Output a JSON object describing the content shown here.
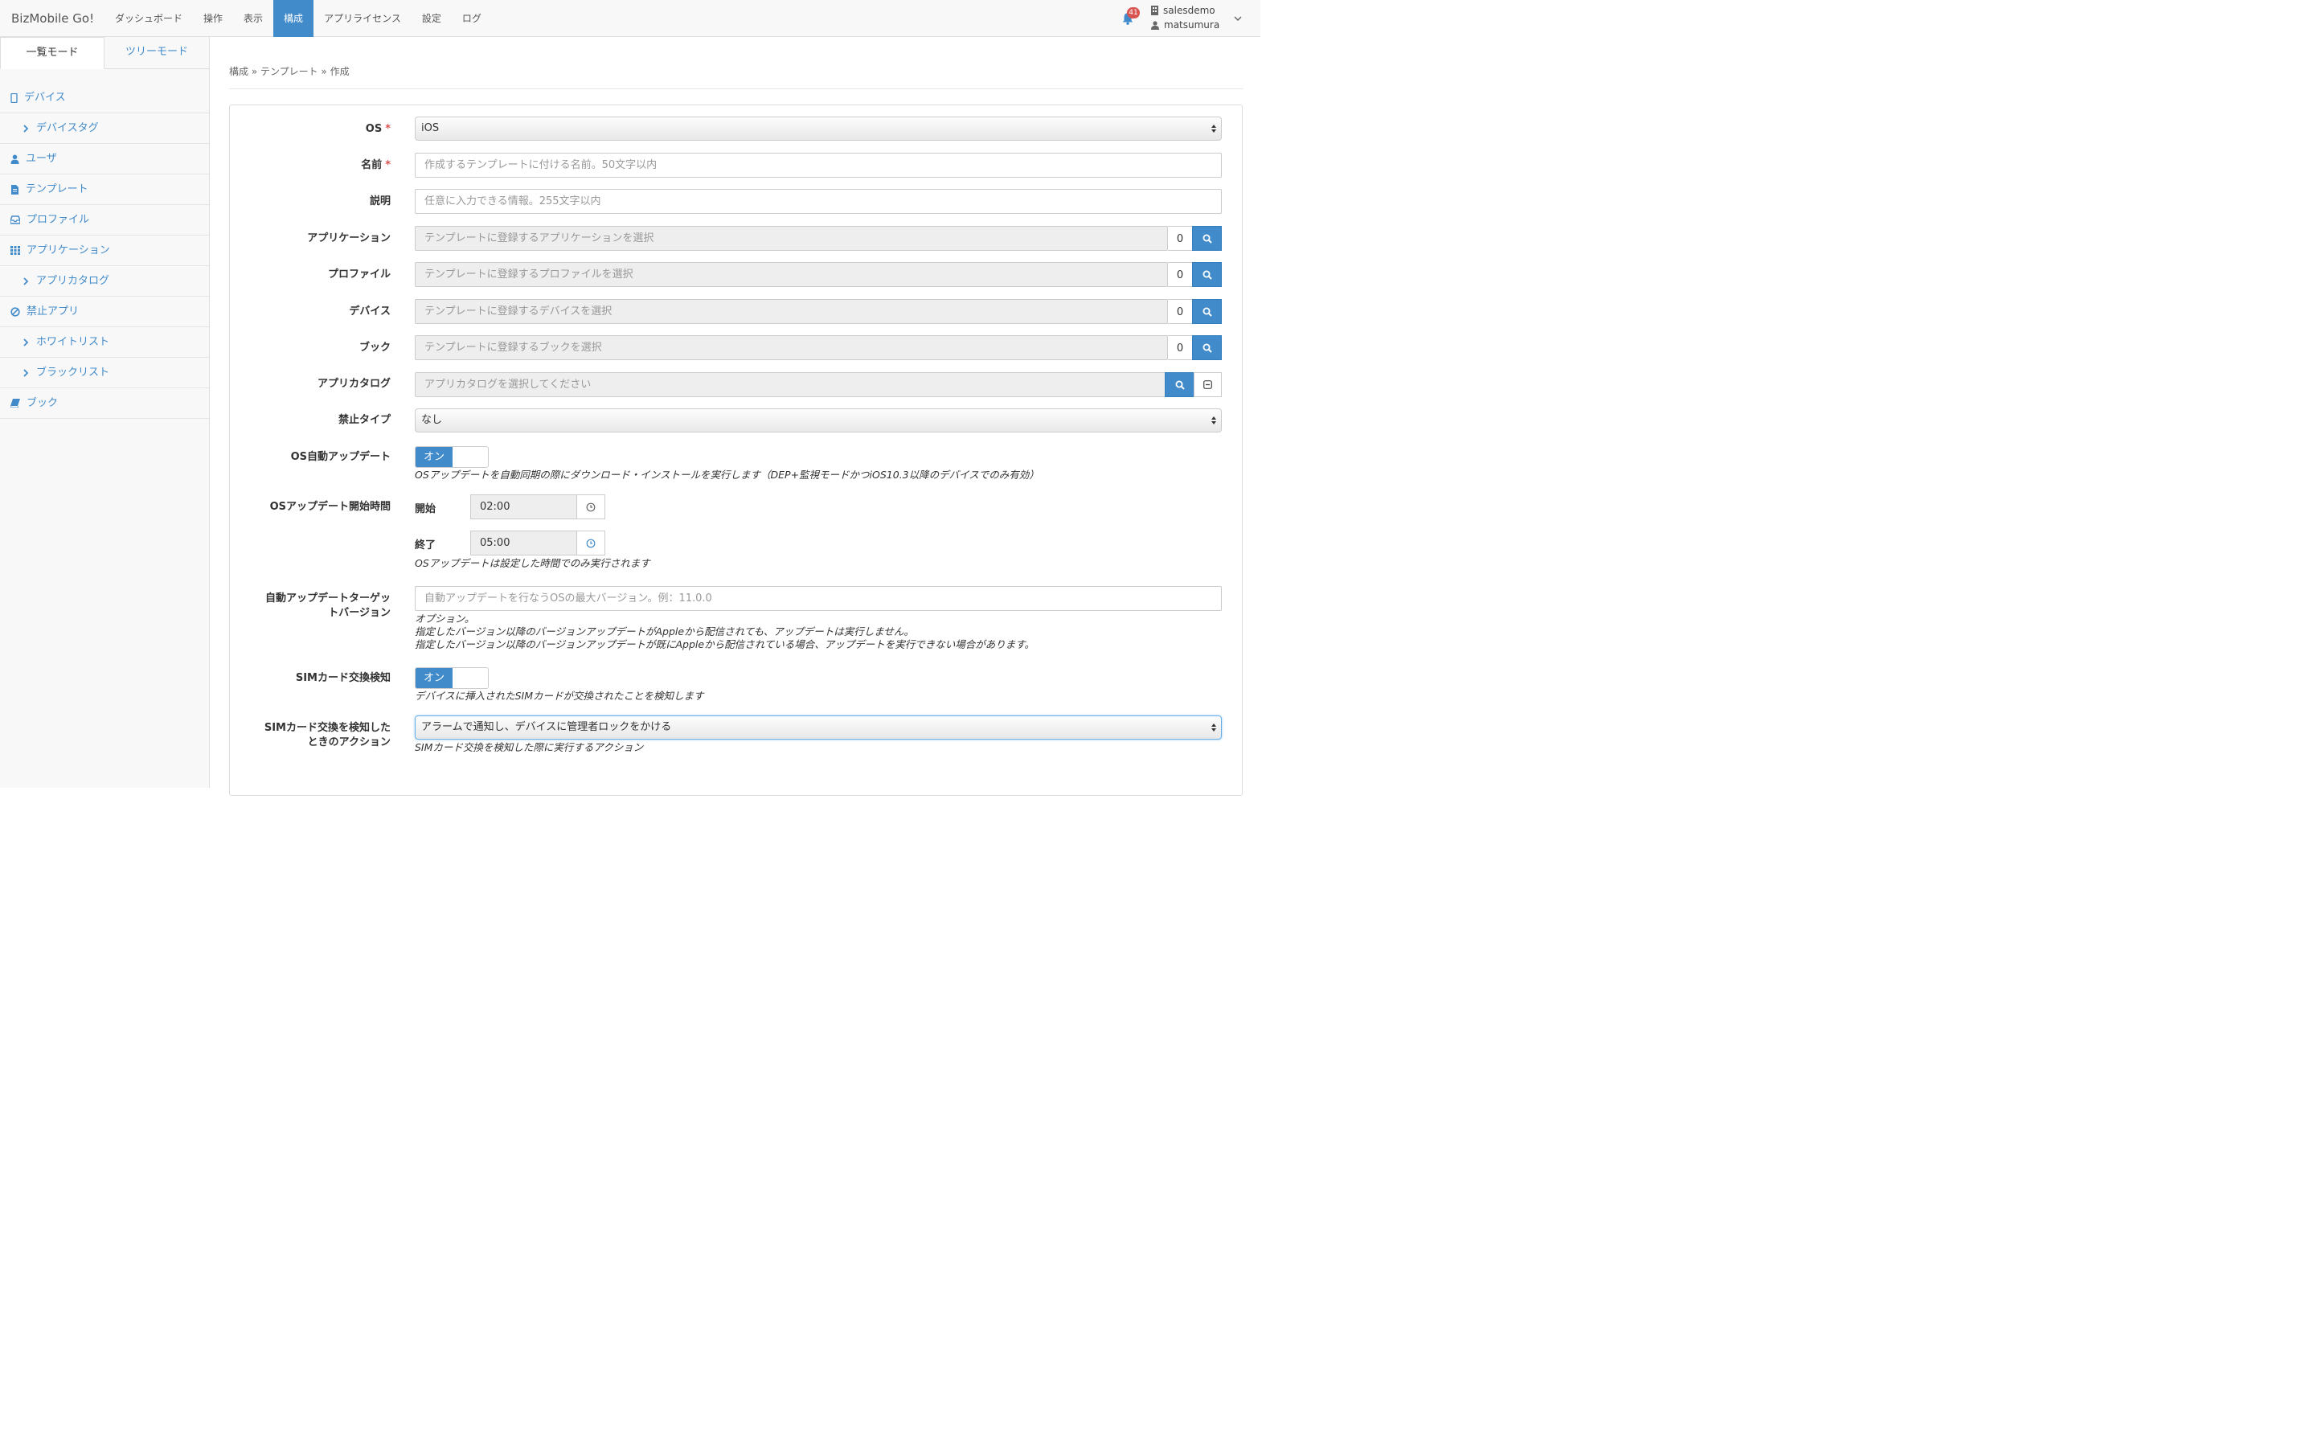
{
  "navbar": {
    "brand": "BizMobile Go!",
    "items": [
      "ダッシュボード",
      "操作",
      "表示",
      "構成",
      "アプリライセンス",
      "設定",
      "ログ"
    ],
    "notifications": "41",
    "user_org": "salesdemo",
    "user_name": "matsumura"
  },
  "sidebar": {
    "tab_list": "一覧モード",
    "tab_tree": "ツリーモード",
    "items": [
      {
        "label": "デバイス",
        "icon": "mobile-icon"
      },
      {
        "label": "デバイスタグ",
        "icon": "chevron-right-icon"
      },
      {
        "label": "ユーザ",
        "icon": "user-icon"
      },
      {
        "label": "テンプレート",
        "icon": "file-icon"
      },
      {
        "label": "プロファイル",
        "icon": "inbox-icon"
      },
      {
        "label": "アプリケーション",
        "icon": "grid-icon"
      },
      {
        "label": "アプリカタログ",
        "icon": "chevron-right-icon"
      },
      {
        "label": "禁止アプリ",
        "icon": "ban-icon"
      },
      {
        "label": "ホワイトリスト",
        "icon": "chevron-right-icon"
      },
      {
        "label": "ブラックリスト",
        "icon": "chevron-right-icon"
      },
      {
        "label": "ブック",
        "icon": "book-icon"
      }
    ]
  },
  "breadcrumb": "構成 » テンプレート » 作成",
  "form": {
    "os_label": "OS",
    "os_value": "iOS",
    "name_label": "名前",
    "name_placeholder": "作成するテンプレートに付ける名前。50文字以内",
    "desc_label": "説明",
    "desc_placeholder": "任意に入力できる情報。255文字以内",
    "app_label": "アプリケーション",
    "app_placeholder": "テンプレートに登録するアプリケーションを選択",
    "app_count": "0",
    "profile_label": "プロファイル",
    "profile_placeholder": "テンプレートに登録するプロファイルを選択",
    "profile_count": "0",
    "device_label": "デバイス",
    "device_placeholder": "テンプレートに登録するデバイスを選択",
    "device_count": "0",
    "book_label": "ブック",
    "book_placeholder": "テンプレートに登録するブックを選択",
    "book_count": "0",
    "catalog_label": "アプリカタログ",
    "catalog_placeholder": "アプリカタログを選択してください",
    "ban_label": "禁止タイプ",
    "ban_value": "なし",
    "os_auto_label": "OS自動アップデート",
    "toggle_on": "オン",
    "os_auto_help": "OSアップデートを自動同期の際にダウンロード・インストールを実行します（DEP+監視モードかつiOS10.3以降のデバイスでのみ有効）",
    "os_time_label": "OSアップデート開始時間",
    "start_label": "開始",
    "start_value": "02:00",
    "end_label": "終了",
    "end_value": "05:00",
    "time_help": "OSアップデートは設定した時間でのみ実行されます",
    "target_label_1": "自動アップデートターゲッ",
    "target_label_2": "トバージョン",
    "target_placeholder": "自動アップデートを行なうOSの最大バージョン。例：11.0.0",
    "target_help_1": "オプション。",
    "target_help_2": "指定したバージョン以降のバージョンアップデートがAppleから配信されても、アップデートは実行しません。",
    "target_help_3": "指定したバージョン以降のバージョンアップデートが既にAppleから配信されている場合、アップデートを実行できない場合があります。",
    "sim_label": "SIMカード交換検知",
    "sim_help": "デバイスに挿入されたSIMカードが交換されたことを検知します",
    "sim_action_label_1": "SIMカード交換を検知した",
    "sim_action_label_2": "ときのアクション",
    "sim_action_value": "アラームで通知し、デバイスに管理者ロックをかける",
    "sim_action_help": "SIMカード交換を検知した際に実行するアクション"
  },
  "colors": {
    "accent": "#428bca",
    "danger": "#d9534f"
  }
}
